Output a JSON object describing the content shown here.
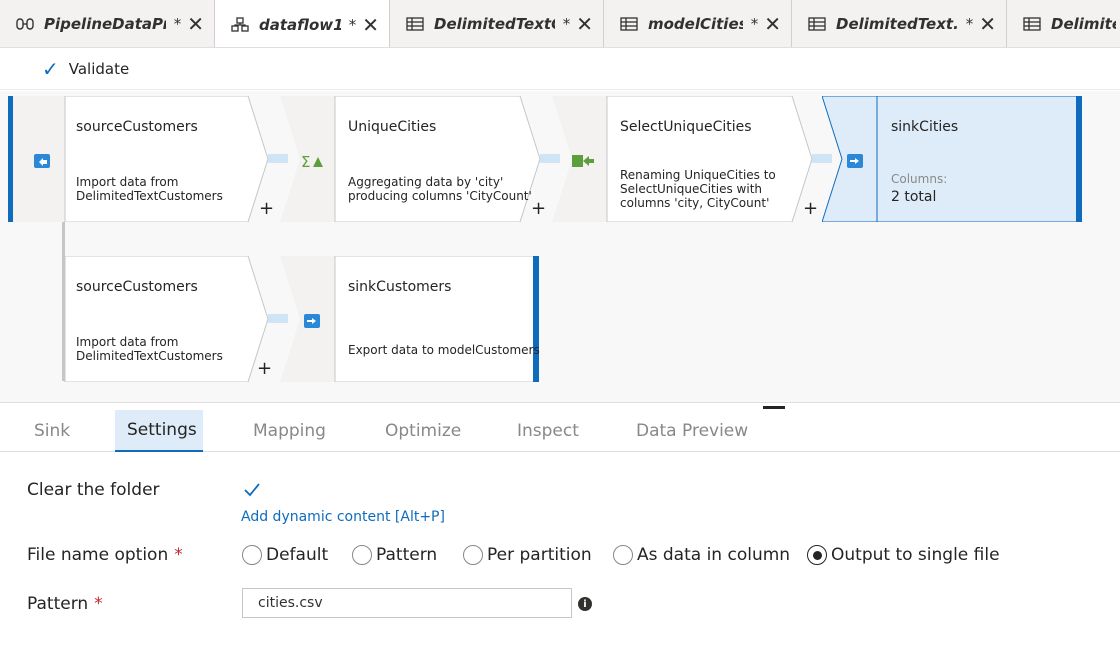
{
  "tabs": [
    {
      "label": "PipelineDataPr...",
      "modified": "*",
      "icon": "pipeline-icon",
      "active": false
    },
    {
      "label": "dataflow1",
      "modified": "*",
      "icon": "dataflow-icon",
      "active": true
    },
    {
      "label": "DelimitedTextC...",
      "modified": "*",
      "icon": "table-icon",
      "active": false
    },
    {
      "label": "modelCities",
      "modified": "*",
      "icon": "table-icon",
      "active": false
    },
    {
      "label": "DelimitedText...",
      "modified": "*",
      "icon": "table-icon",
      "active": false
    },
    {
      "label": "Delimited",
      "modified": "",
      "icon": "table-icon",
      "active": false
    }
  ],
  "toolbar": {
    "validate_label": "Validate"
  },
  "flow": {
    "row1": [
      {
        "title": "sourceCustomers",
        "desc": "Import data from\nDelimitedTextCustomers",
        "icon": "source-icon"
      },
      {
        "title": "UniqueCities",
        "desc": "Aggregating data by 'city'\nproducing columns 'CityCount'",
        "icon": "aggregate-icon"
      },
      {
        "title": "SelectUniqueCities",
        "desc": "Renaming UniqueCities to\nSelectUniqueCities with\ncolumns 'city, CityCount'",
        "icon": "select-icon"
      },
      {
        "title": "sinkCities",
        "columns_label": "Columns:",
        "columns_value": "2 total",
        "icon": "sink-icon"
      }
    ],
    "row2": [
      {
        "title": "sourceCustomers",
        "desc": "Import data from\nDelimitedTextCustomers"
      },
      {
        "title": "sinkCustomers",
        "desc": "Export data to modelCustomers",
        "icon": "sink-icon"
      }
    ],
    "plus": "+"
  },
  "panel_tabs": [
    {
      "label": "Sink",
      "active": false
    },
    {
      "label": "Settings",
      "active": true
    },
    {
      "label": "Mapping",
      "active": false
    },
    {
      "label": "Optimize",
      "active": false
    },
    {
      "label": "Inspect",
      "active": false
    },
    {
      "label": "Data Preview",
      "active": false
    }
  ],
  "settings": {
    "clear_folder_label": "Clear the folder",
    "clear_folder_checked": true,
    "dynamic_link": "Add dynamic content [Alt+P]",
    "file_name_option_label": "File name option",
    "required_mark": "*",
    "file_name_options": [
      "Default",
      "Pattern",
      "Per partition",
      "As data in column",
      "Output to single file"
    ],
    "file_name_selected": "Output to single file",
    "pattern_label": "Pattern",
    "pattern_value": "cities.csv",
    "info_glyph": "i"
  },
  "colors": {
    "accent": "#0f6cbd",
    "selected_node": "#deecf9",
    "connector": "#cfe4f5"
  }
}
